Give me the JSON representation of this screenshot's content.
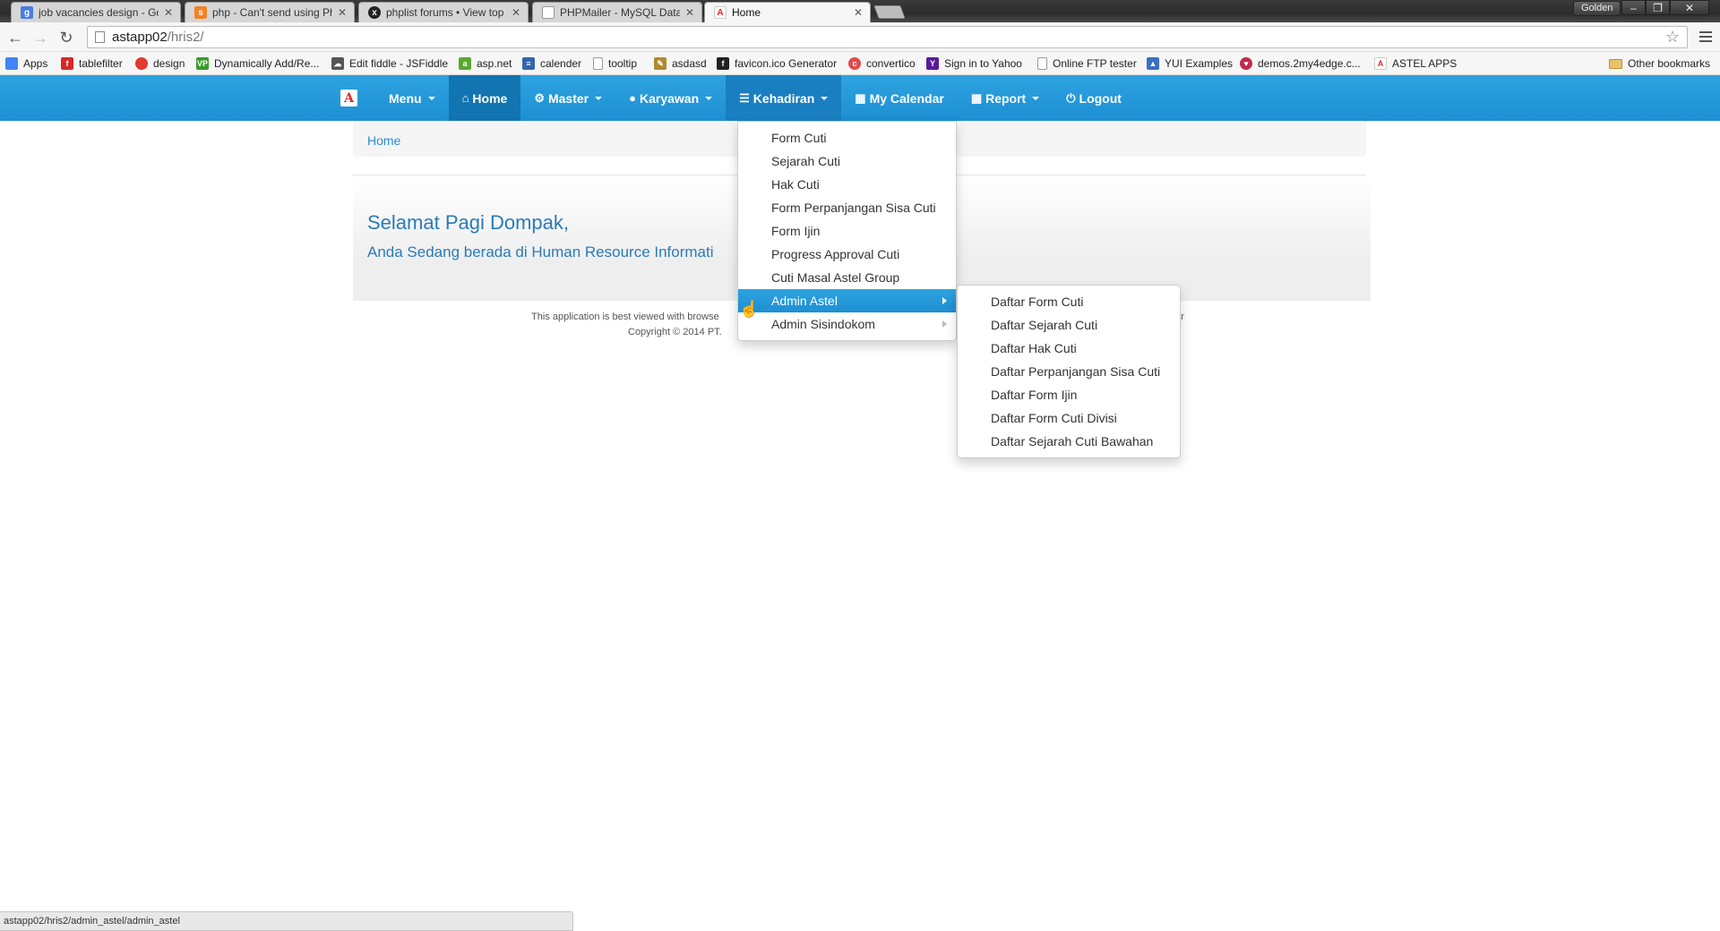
{
  "browser": {
    "tabs": [
      {
        "title": "job vacancies design - Go",
        "icon": "google-icon",
        "color": "#4a7de2",
        "glyph": "g"
      },
      {
        "title": "php - Can't send using Ph",
        "icon": "stackoverflow-icon",
        "color": "#f48024",
        "glyph": "s"
      },
      {
        "title": "phplist forums • View top",
        "icon": "phplist-icon",
        "color": "#222222",
        "glyph": "x"
      },
      {
        "title": "PHPMailer - MySQL Datab",
        "icon": "page-icon",
        "color": "#999999",
        "glyph": ""
      },
      {
        "title": "Home",
        "icon": "astel-icon",
        "color": "#e0262b",
        "glyph": "A"
      }
    ],
    "user_label": "Golden",
    "url_host": "astapp02",
    "url_path": "/hris2/",
    "bookmarks": [
      {
        "label": "Apps",
        "icon": "apps-icon",
        "color": "#4285f4",
        "glyph": "⋮"
      },
      {
        "label": "tablefilter",
        "icon": "free-icon",
        "color": "#d62828",
        "glyph": "f"
      },
      {
        "label": "design",
        "icon": "hexagon-icon",
        "color": "#e03a2e",
        "glyph": ""
      },
      {
        "label": "Dynamically Add/Re...",
        "icon": "vp-icon",
        "color": "#3c9a2b",
        "glyph": "VP"
      },
      {
        "label": "Edit fiddle - JSFiddle",
        "icon": "cloud-icon",
        "color": "#555555",
        "glyph": "☁"
      },
      {
        "label": "asp.net",
        "icon": "aspnet-icon",
        "color": "#5aa832",
        "glyph": "a"
      },
      {
        "label": "calender",
        "icon": "calendar-icon",
        "color": "#3366aa",
        "glyph": "≡"
      },
      {
        "label": "tooltip",
        "icon": "page-icon",
        "color": "#999999",
        "glyph": ""
      },
      {
        "label": "asdasd",
        "icon": "pen-icon",
        "color": "#b08a2e",
        "glyph": "✎"
      },
      {
        "label": "favicon.ico Generator",
        "icon": "favicon-icon",
        "color": "#222222",
        "glyph": "f"
      },
      {
        "label": "convertico",
        "icon": "convertico-icon",
        "color": "#e44a4a",
        "glyph": "c"
      },
      {
        "label": "Sign in to Yahoo",
        "icon": "yahoo-icon",
        "color": "#5a1a9a",
        "glyph": "Y"
      },
      {
        "label": "Online FTP tester",
        "icon": "page-icon",
        "color": "#999999",
        "glyph": ""
      },
      {
        "label": "YUI Examples",
        "icon": "yui-icon",
        "color": "#3a6fc4",
        "glyph": "▲"
      },
      {
        "label": "demos.2my4edge.c...",
        "icon": "demo-icon",
        "color": "#c02a4a",
        "glyph": "♥"
      },
      {
        "label": "ASTEL APPS",
        "icon": "astel-icon",
        "color": "#e0262b",
        "glyph": "A"
      }
    ],
    "other_bookmarks": "Other bookmarks",
    "status_url": "astapp02/hris2/admin_astel/admin_astel"
  },
  "navbar": {
    "brand": "A",
    "items": [
      {
        "label": "Menu",
        "icon": "",
        "caret": true
      },
      {
        "label": "Home",
        "icon": "⌂",
        "caret": false
      },
      {
        "label": "Master",
        "icon": "⚙",
        "caret": true
      },
      {
        "label": "Karyawan",
        "icon": "👤",
        "caret": true
      },
      {
        "label": "Kehadiran",
        "icon": "☰",
        "caret": true
      },
      {
        "label": "My Calendar",
        "icon": "▦",
        "caret": false
      },
      {
        "label": "Report",
        "icon": "▦",
        "caret": true
      },
      {
        "label": "Logout",
        "icon": "⏻",
        "caret": false
      }
    ]
  },
  "breadcrumb": "Home",
  "greeting": "Selamat Pagi Dompak,",
  "subgreeting": "Anda Sedang berada di Human Resource Informati",
  "footer": {
    "line1_left": "This application is best viewed with browse",
    "line1_right": "er",
    "line2": "Copyright © 2014 PT."
  },
  "kehadiran_menu": [
    {
      "label": "Form Cuti"
    },
    {
      "label": "Sejarah Cuti"
    },
    {
      "label": "Hak Cuti"
    },
    {
      "label": "Form Perpanjangan Sisa Cuti"
    },
    {
      "label": "Form Ijin"
    },
    {
      "label": "Progress Approval Cuti"
    },
    {
      "label": "Cuti Masal Astel Group"
    },
    {
      "label": "Admin Astel"
    },
    {
      "label": "Admin Sisindokom"
    }
  ],
  "admin_astel_menu": [
    {
      "label": "Daftar Form Cuti"
    },
    {
      "label": "Daftar Sejarah Cuti"
    },
    {
      "label": "Daftar Hak Cuti"
    },
    {
      "label": "Daftar Perpanjangan Sisa Cuti"
    },
    {
      "label": "Daftar Form Ijin"
    },
    {
      "label": "Daftar Form Cuti Divisi"
    },
    {
      "label": "Daftar Sejarah Cuti Bawahan"
    }
  ],
  "colors": {
    "navbar": "#1d8fd3",
    "navbar_active": "#1274b0",
    "link": "#2a8ad4",
    "greeting": "#2a7bb8"
  }
}
